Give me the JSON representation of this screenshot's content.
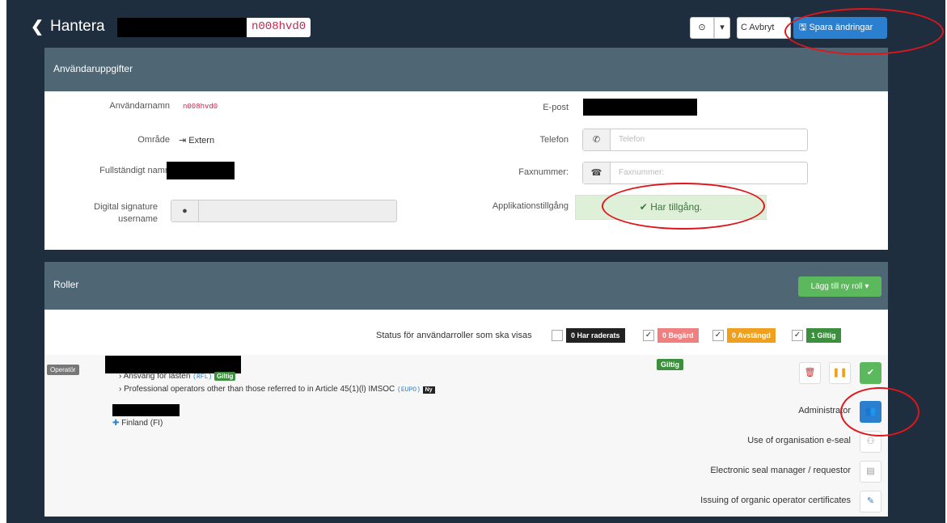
{
  "header": {
    "back_icon": "chevron-left-icon",
    "title": "Hantera",
    "username_code": "n008hvd0",
    "history_icon": "clock-icon",
    "caret": "▾",
    "cancel_label": "Avbryt",
    "save_label": "Spara ändringar"
  },
  "user_panel": {
    "heading": "Användaruppgifter",
    "username_label": "Användarnamn",
    "username_value": "n008hvd0",
    "area_label": "Område",
    "area_value": "Extern",
    "fullname_label": "Fullständigt namn",
    "digital_sig_label_1": "Digital signature",
    "digital_sig_label_2": "username",
    "email_label": "E-post",
    "phone_label": "Telefon",
    "phone_placeholder": "Telefon",
    "fax_label": "Faxnummer:",
    "fax_placeholder": "Faxnummer:",
    "app_access_label": "Applikationstillgång",
    "app_access_value": "Har tillgång."
  },
  "roles_panel": {
    "heading": "Roller",
    "add_role_label": "Lägg till ny roll",
    "filter_label": "Status för användarroller som ska visas",
    "filters": [
      {
        "label": "0 Har raderats",
        "color": "#222222",
        "checked": false
      },
      {
        "label": "0 Begärd",
        "color": "#f08080",
        "checked": true
      },
      {
        "label": "0 Avstängd",
        "color": "#f0a020",
        "checked": true
      },
      {
        "label": "1 Giltig",
        "color": "#3c8f3c",
        "checked": true
      }
    ],
    "role": {
      "type_label": "Operatör",
      "status": "Giltig",
      "line1_text": "Ansvarig för lasten",
      "line1_code": "(RFL)",
      "line1_badge": "Giltig",
      "line2_text": "Professional operators other than those referred to in Article 45(1)(l) IMSOC",
      "line2_code": "(EUPO)",
      "line2_badge": "Ny",
      "country": "Finland (FI)"
    },
    "permissions": [
      {
        "label": "Administrator",
        "icon": "users-icon",
        "active": true
      },
      {
        "label": "Use of organisation e-seal",
        "icon": "seal-icon",
        "active": false
      },
      {
        "label": "Electronic seal manager / requestor",
        "icon": "id-card-icon",
        "active": false
      },
      {
        "label": "Issuing of organic operator certificates",
        "icon": "pencil-icon",
        "active": false
      }
    ]
  },
  "colors": {
    "primary": "#2a7fcf",
    "success": "#5cb85c",
    "panel_header": "#4f6675",
    "annotation": "#e0161a"
  }
}
